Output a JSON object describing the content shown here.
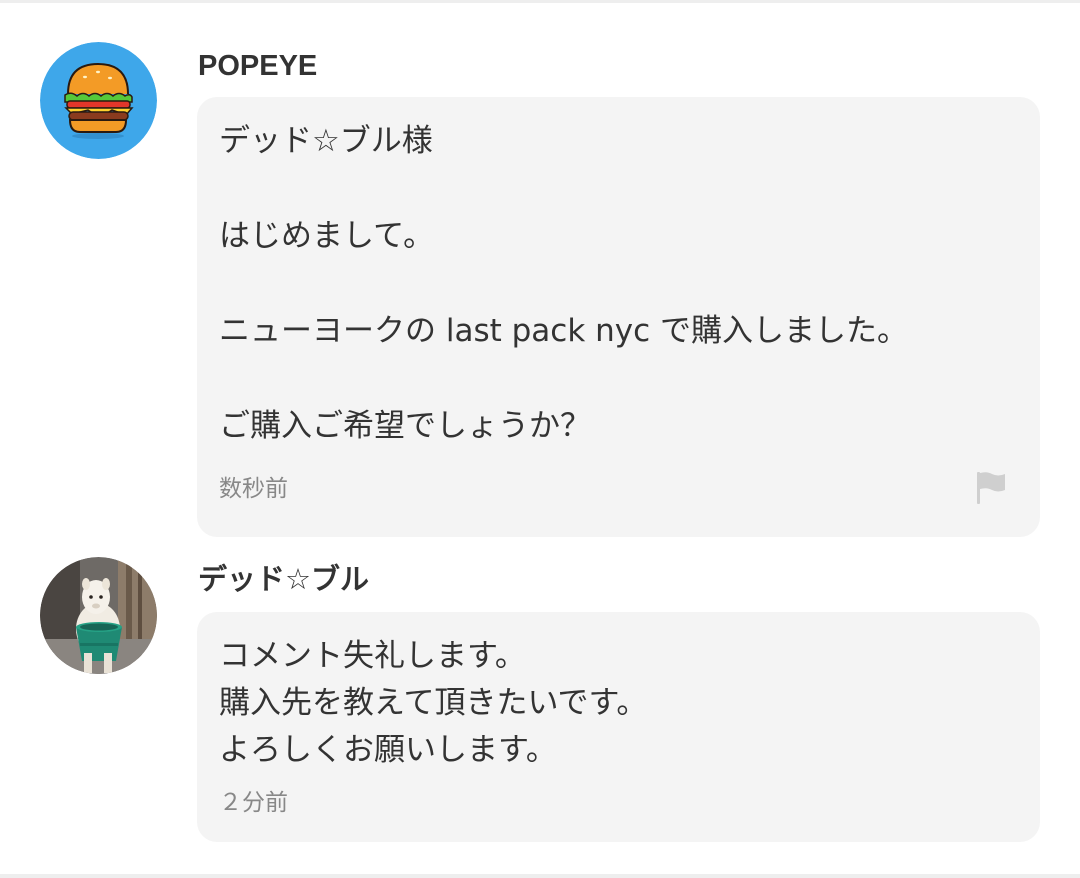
{
  "comments": [
    {
      "username": "POPEYE",
      "avatar_icon": "hamburger-icon",
      "avatar_bg": "#3ea7ea",
      "lines": [
        "デッド☆ブル様",
        "はじめまして。",
        "ニューヨークの last pack nyc で購入しました。",
        "ご購入ご希望でしょうか？"
      ],
      "timestamp": "数秒前",
      "report_icon": "flag-icon"
    },
    {
      "username": "デッド☆ブル",
      "avatar_icon": "alpaca-photo",
      "lines": [
        "コメント失礼します。",
        "購入先を教えて頂きたいです。",
        "よろしくお願いします。"
      ],
      "timestamp": "２分前"
    }
  ],
  "colors": {
    "bubble_bg": "#f4f4f4",
    "text": "#333333",
    "muted_text": "#888888",
    "flag": "#cfcfcf"
  }
}
